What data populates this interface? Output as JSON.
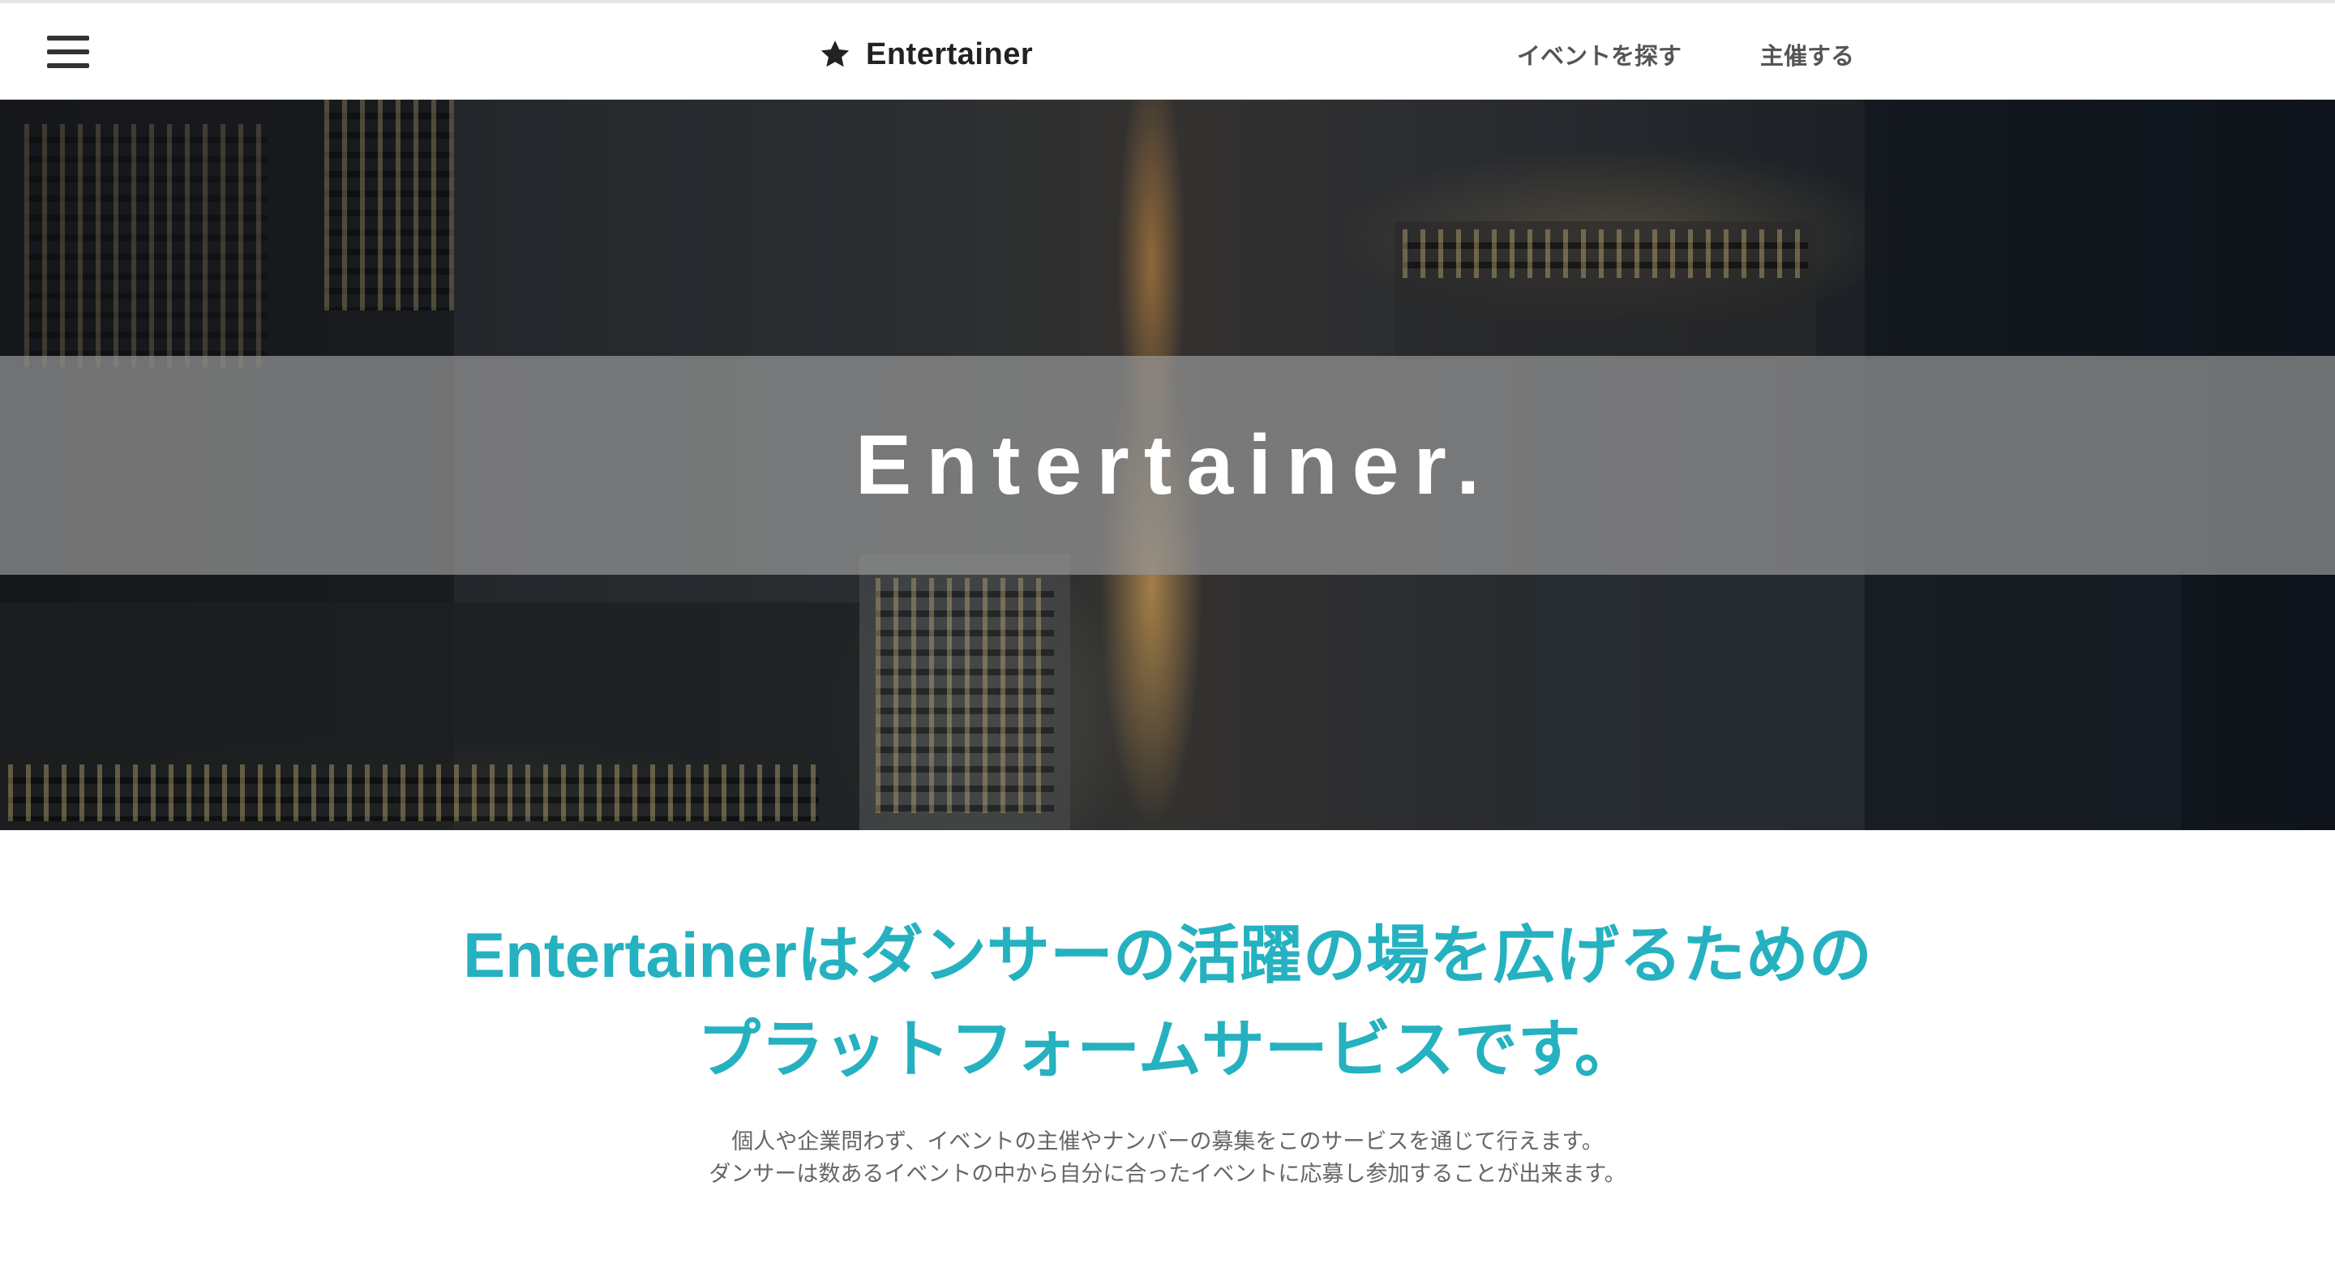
{
  "header": {
    "menu_icon": "hamburger-menu-icon",
    "brand_icon": "star-icon",
    "brand_label": "Entertainer",
    "nav": [
      {
        "label": "イベントを探す"
      },
      {
        "label": "主催する"
      }
    ]
  },
  "hero": {
    "background": "night-city-aerial-photo",
    "title": "Entertainer."
  },
  "main": {
    "headline_line1": "Entertainerはダンサーの活躍の場を広げるための",
    "headline_line2": "プラットフォームサービスです。",
    "headline_color": "#25b1c0",
    "description_line1": "個人や企業問わず、イベントの主催やナンバーの募集をこのサービスを通じて行えます。",
    "description_line2": "ダンサーは数あるイベントの中から自分に合ったイベントに応募し参加することが出来ます。"
  }
}
